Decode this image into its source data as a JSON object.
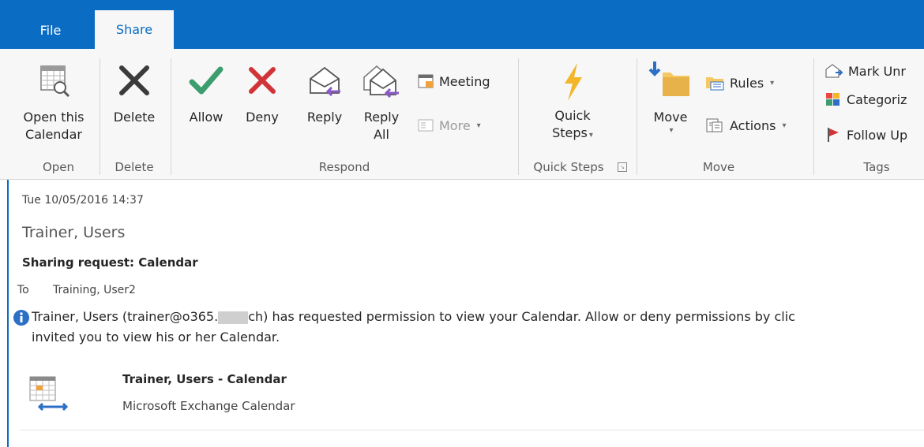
{
  "tabs": [
    {
      "label": "File"
    },
    {
      "label": "Share"
    }
  ],
  "ribbon": {
    "open_this_calendar": "Open this\nCalendar",
    "open_line1": "Open this",
    "open_line2": "Calendar",
    "delete": "Delete",
    "allow": "Allow",
    "deny": "Deny",
    "reply": "Reply",
    "reply_all_line1": "Reply",
    "reply_all_line2": "All",
    "meeting": "Meeting",
    "more": "More",
    "quick_steps_line1": "Quick",
    "quick_steps_line2": "Steps",
    "move": "Move",
    "rules": "Rules",
    "actions": "Actions",
    "mark_unread": "Mark Unr",
    "categorize": "Categoriz",
    "follow_up": "Follow Up",
    "groups": {
      "open": "Open",
      "delete": "Delete",
      "respond": "Respond",
      "quick_steps": "Quick Steps",
      "move": "Move",
      "tags": "Tags"
    }
  },
  "message": {
    "date": "Tue 10/05/2016 14:37",
    "sender": "Trainer, Users",
    "subject": "Sharing request: Calendar",
    "to_label": "To",
    "to_value": "Training, User2",
    "info_line1_a": "Trainer, Users (trainer@o365.",
    "info_line1_b": "ch) has requested permission to view your Calendar. Allow or deny permissions by clic",
    "info_line2": "invited you to view his or her Calendar.",
    "calendar_title": "Trainer, Users - Calendar",
    "calendar_subtitle": "Microsoft Exchange Calendar"
  },
  "colors": {
    "accent": "#0a6cc2",
    "allow": "#3c9d6f",
    "deny": "#d13438",
    "quick_steps": "#f2b628",
    "reply_arrow": "#8a5ac5"
  }
}
